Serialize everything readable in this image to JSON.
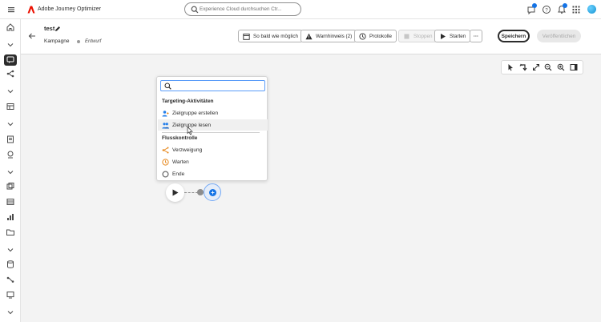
{
  "topbar": {
    "app_name": "Adobe Journey Optimizer",
    "search_placeholder": "Experience Cloud durchsuchen Ctr...",
    "brand_color": "#eb1000"
  },
  "header": {
    "title": "test",
    "type": "Kampagne",
    "status": "Entwurf",
    "buttons": {
      "schedule": "So bald wie möglich",
      "warnings": "Warnhinweis (2)",
      "logs": "Protokolle",
      "stop": "Stoppen",
      "start": "Starten",
      "more": "···",
      "save": "Speichern",
      "publish": "Veröffentlichen"
    }
  },
  "popup": {
    "search_value": "",
    "sections": [
      {
        "title": "Targeting-Aktivitäten",
        "items": [
          {
            "label": "Zielgruppe erstellen",
            "icon": "build-audience-icon"
          },
          {
            "label": "Zielgruppe lesen",
            "icon": "read-audience-icon"
          }
        ]
      },
      {
        "title": "Flusskontrolle",
        "items": [
          {
            "label": "Verzweigung",
            "icon": "fork-icon"
          },
          {
            "label": "Warten",
            "icon": "wait-icon"
          },
          {
            "label": "Ende",
            "icon": "end-icon"
          }
        ]
      }
    ]
  },
  "colors": {
    "accent": "#1473e6",
    "orange_icon": "#e68619",
    "blue_icon": "#2680eb"
  }
}
